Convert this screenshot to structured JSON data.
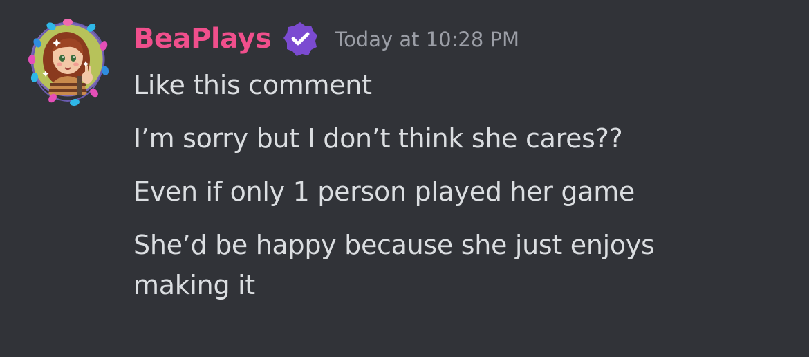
{
  "message": {
    "author": {
      "name": "BeaPlays",
      "name_color": "#f04f8c",
      "avatar_icon": "avatar-girl-with-fairy-lights-icon",
      "badge_icon": "verified-check-badge-icon",
      "badge_color": "#7b4bd1"
    },
    "timestamp": "Today at 10:28 PM",
    "lines": [
      "Like this comment",
      "I’m sorry but I don’t think she cares??",
      "Even if only 1 person played her game",
      "She’d be happy because she just enjoys making it"
    ]
  },
  "theme": {
    "background": "#313338",
    "text": "#dbdee1",
    "muted": "#9b9ea6"
  }
}
